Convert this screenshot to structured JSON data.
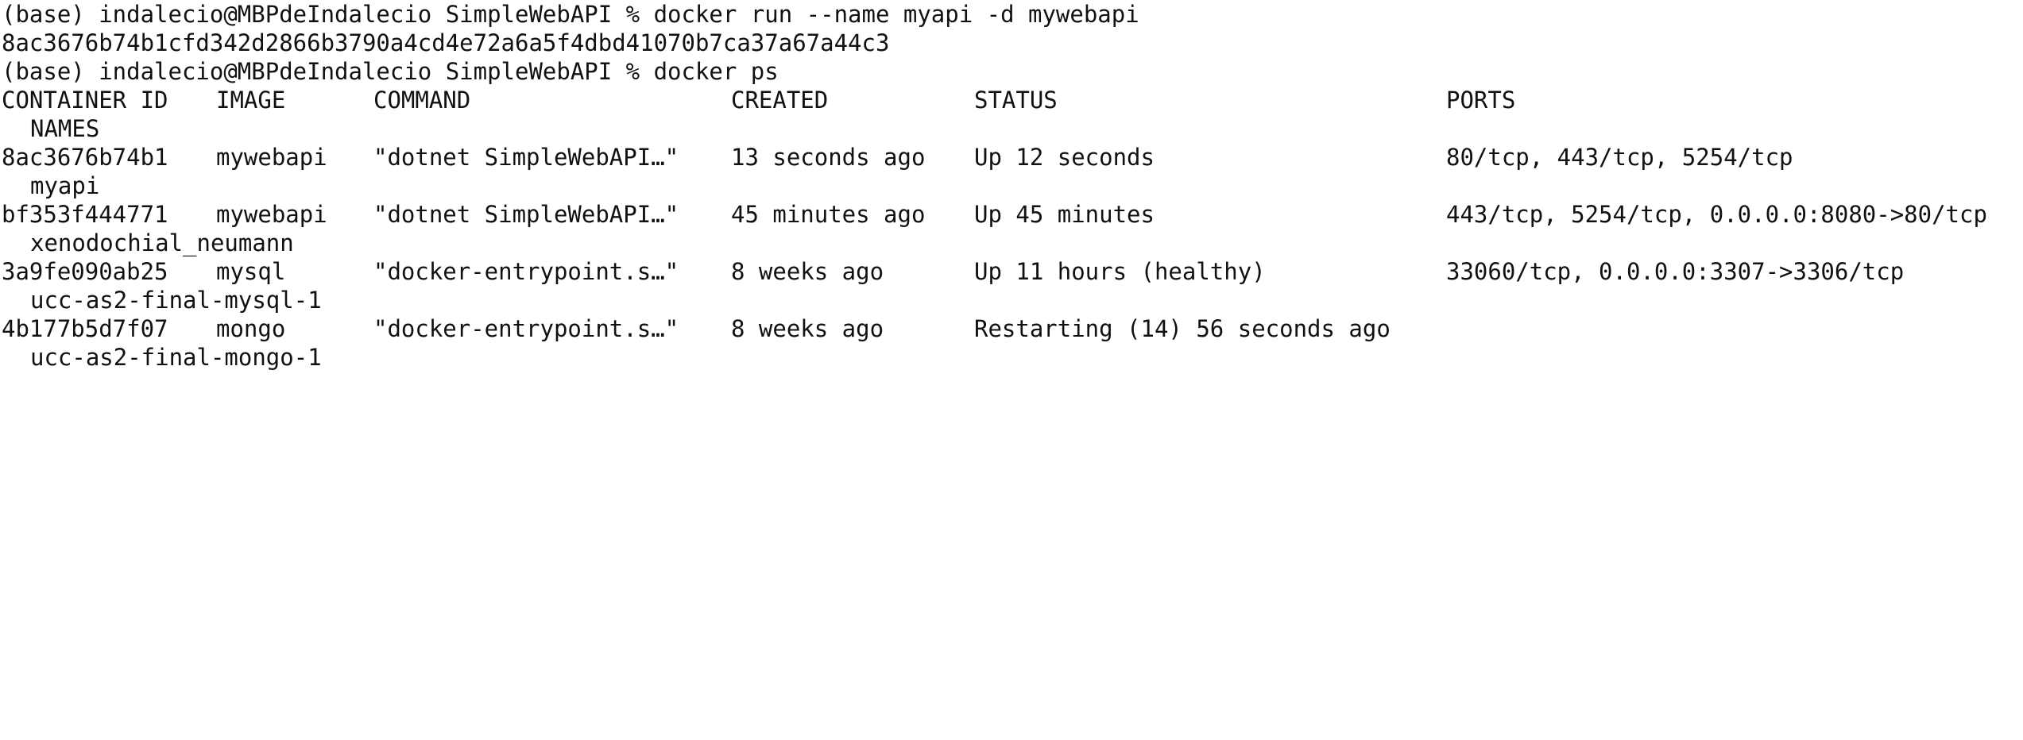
{
  "lines": [
    {
      "text": "(base) indalecio@MBPdeIndalecio SimpleWebAPI % docker run --name myapi -d mywebapi"
    },
    {
      "text": "8ac3676b74b1cfd342d2866b3790a4cd4e72a6a5f4dbd41070b7ca37a67a44c3"
    },
    {
      "text": "(base) indalecio@MBPdeIndalecio SimpleWebAPI % docker ps"
    }
  ],
  "ps_table": {
    "headers": {
      "container_id": "CONTAINER ID",
      "image": "IMAGE",
      "command": "COMMAND",
      "created": "CREATED",
      "status": "STATUS",
      "ports": "PORTS",
      "names": "NAMES"
    },
    "rows": [
      {
        "container_id": "8ac3676b74b1",
        "image": "mywebapi",
        "command": "\"dotnet SimpleWebAPI…\"",
        "created": "13 seconds ago",
        "status": "Up 12 seconds",
        "ports": "80/tcp, 443/tcp, 5254/tcp",
        "name": "myapi"
      },
      {
        "container_id": "bf353f444771",
        "image": "mywebapi",
        "command": "\"dotnet SimpleWebAPI…\"",
        "created": "45 minutes ago",
        "status": "Up 45 minutes",
        "ports": "443/tcp, 5254/tcp, 0.0.0.0:8080->80/tcp",
        "name": "xenodochial_neumann"
      },
      {
        "container_id": "3a9fe090ab25",
        "image": "mysql",
        "command": "\"docker-entrypoint.s…\"",
        "created": "8 weeks ago",
        "status": "Up 11 hours (healthy)",
        "ports": "33060/tcp, 0.0.0.0:3307->3306/tcp",
        "name": "ucc-as2-final-mysql-1"
      },
      {
        "container_id": "4b177b5d7f07",
        "image": "mongo",
        "command": "\"docker-entrypoint.s…\"",
        "created": "8 weeks ago",
        "status": "Restarting (14) 56 seconds ago",
        "ports": "",
        "name": "ucc-as2-final-mongo-1"
      }
    ]
  }
}
